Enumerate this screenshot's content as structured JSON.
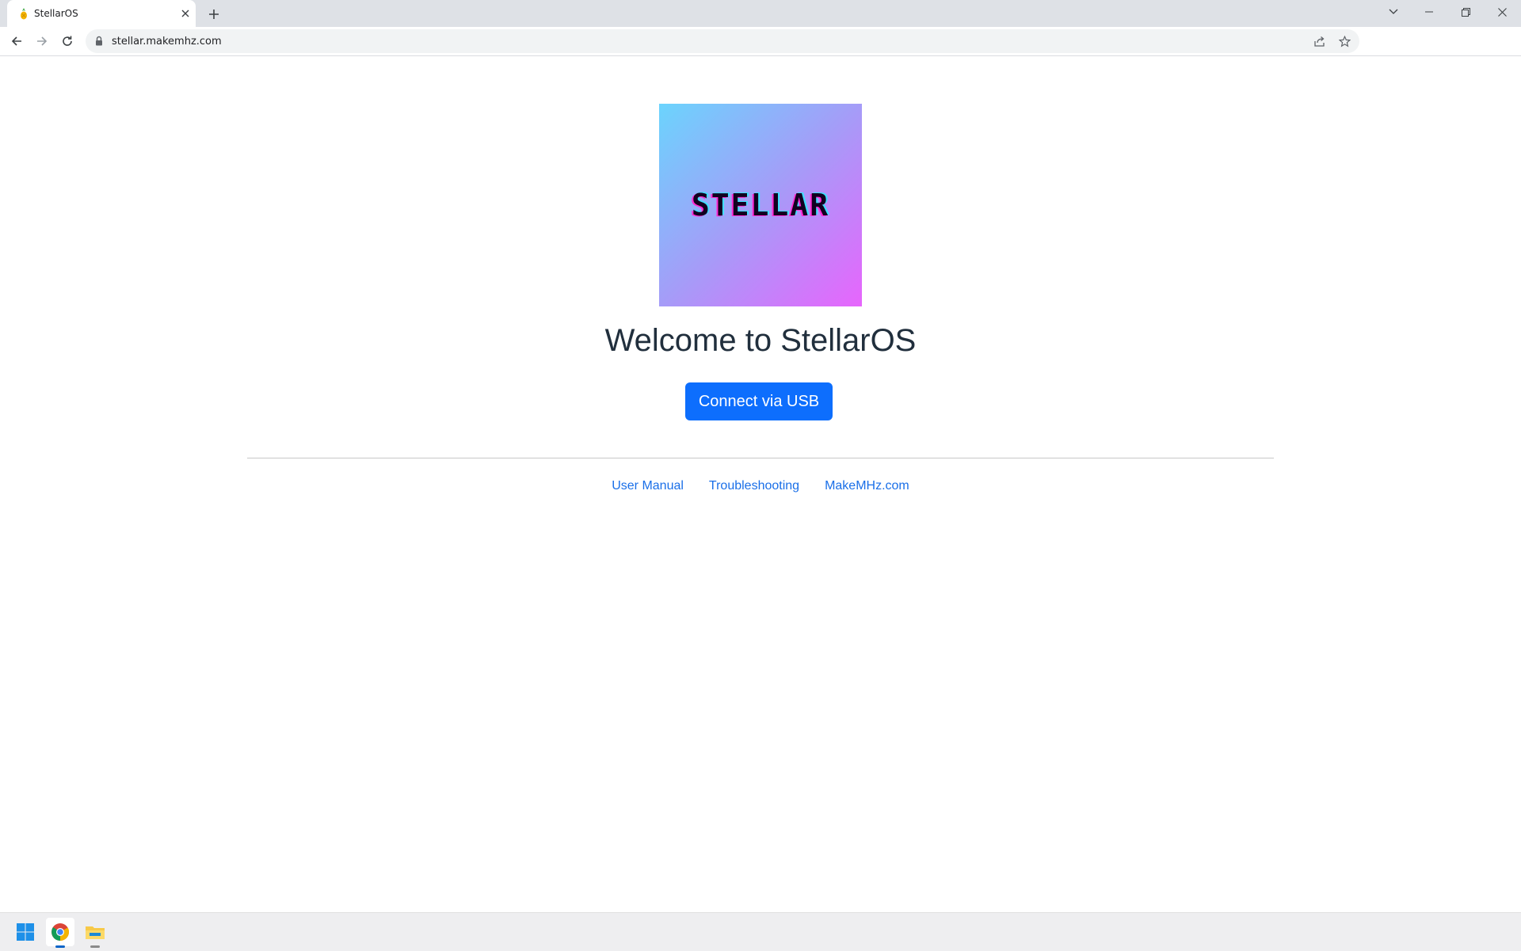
{
  "browser": {
    "tab_title": "StellarOS",
    "url": "stellar.makemhz.com"
  },
  "page": {
    "logo_text": "STELLAR",
    "heading": "Welcome to StellarOS",
    "connect_button": "Connect via USB",
    "footer_links": [
      "User Manual",
      "Troubleshooting",
      "MakeMHz.com"
    ]
  },
  "colors": {
    "accent": "#0d6efd",
    "link": "#1a6fe8",
    "heading": "#212f3d",
    "logo_gradient": [
      "#6bd4fd",
      "#a59cf8",
      "#e765fc"
    ]
  },
  "icons": {
    "tab_favicon": "pineapple-icon",
    "taskbar": [
      "windows-start-icon",
      "chrome-icon",
      "file-explorer-icon"
    ]
  }
}
